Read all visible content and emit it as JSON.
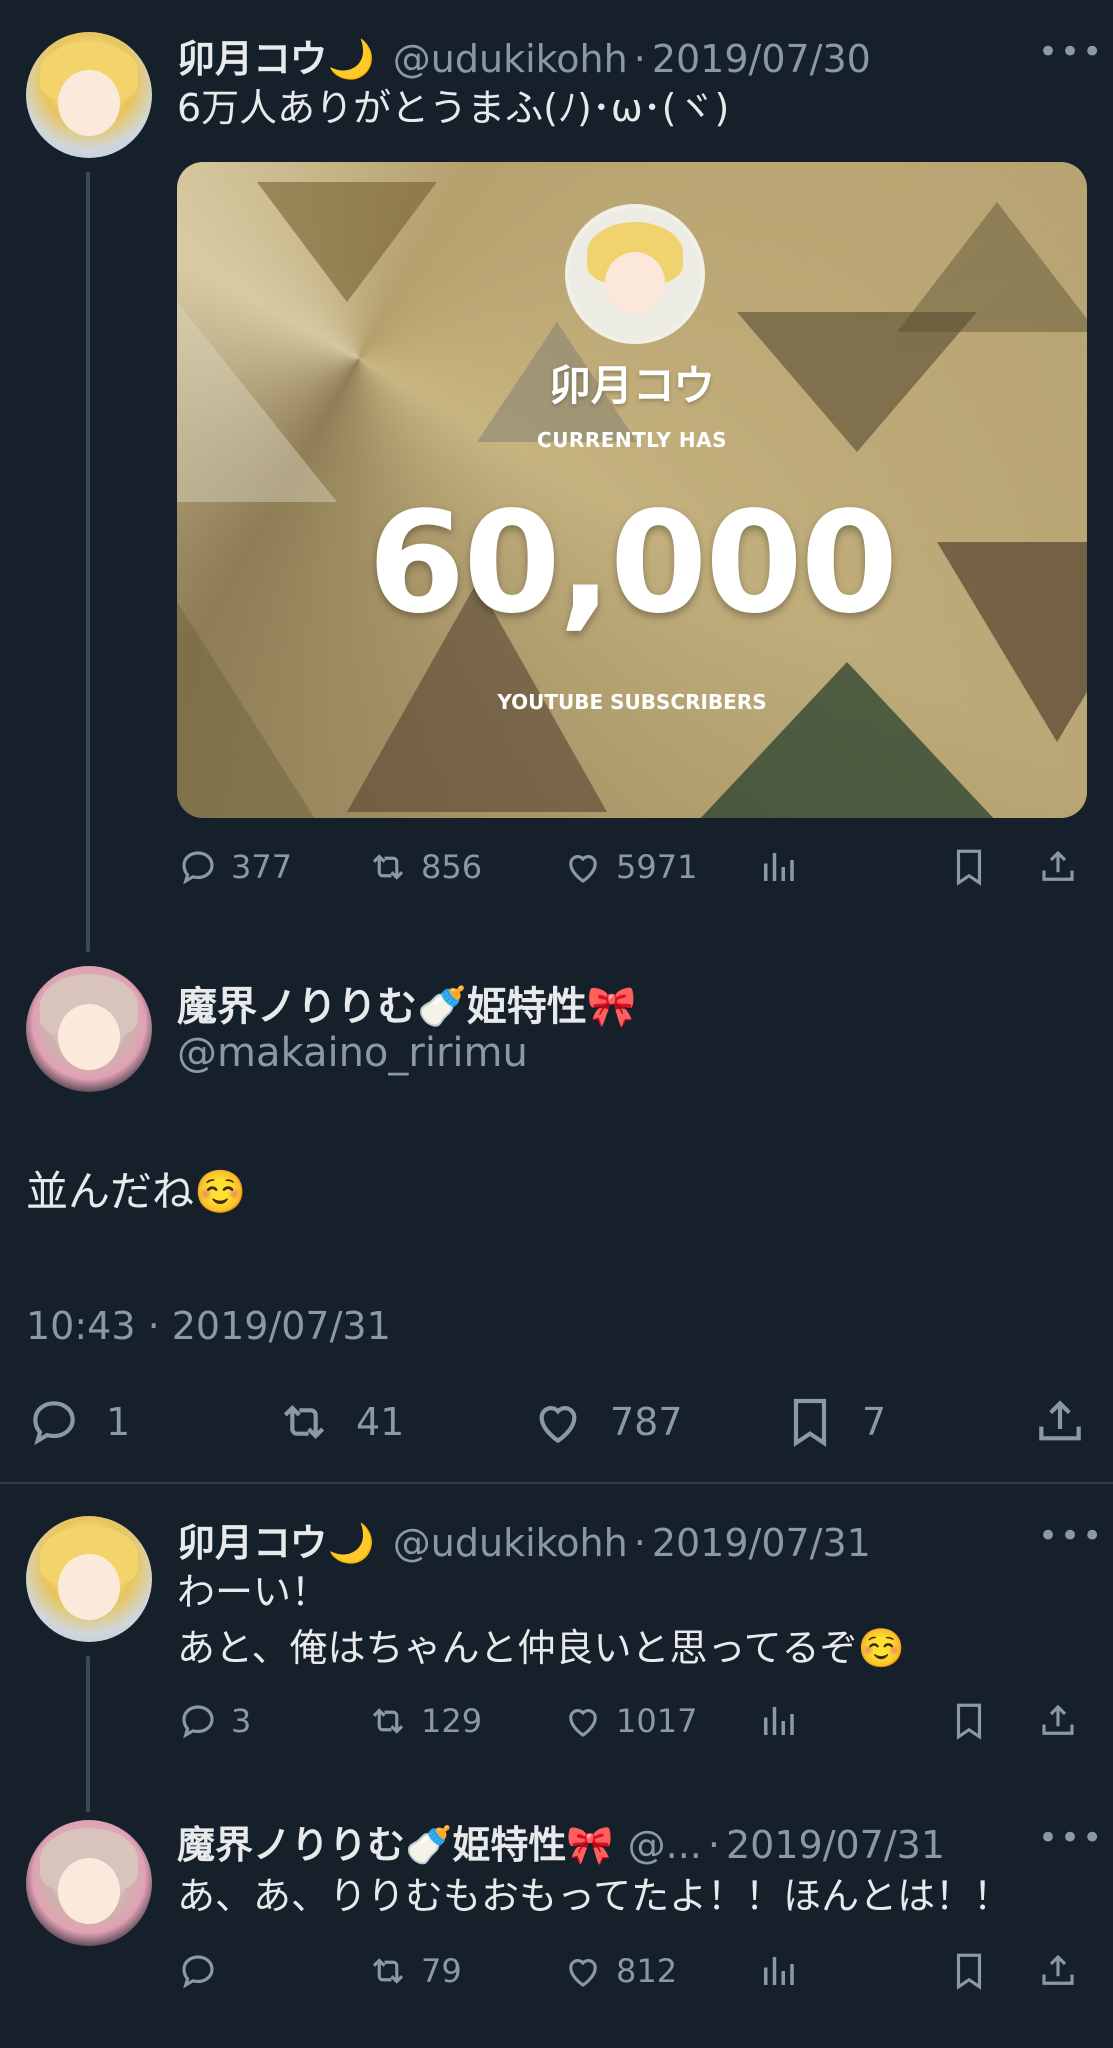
{
  "tweet1": {
    "name": "卯月コウ🌙",
    "handle": "@udukikohh",
    "sep": "·",
    "date": "2019/07/30",
    "more": "•••",
    "text": "6万人ありがとうまふ(ﾉ)･ω･(ヾ)",
    "card": {
      "name": "卯月コウ",
      "currently": "CURRENTLY HAS",
      "count": "60,000",
      "footer": "YOUTUBE SUBSCRIBERS"
    },
    "actions": {
      "replies": "377",
      "retweets": "856",
      "likes": "5971"
    }
  },
  "tweet2": {
    "name": "魔界ノりりむ🍼姫特性🎀",
    "handle": "@makaino_ririmu",
    "text": "並んだね☺️",
    "timestamp": "10:43 · 2019/07/31",
    "actions": {
      "replies": "1",
      "retweets": "41",
      "likes": "787",
      "bookmarks": "7"
    }
  },
  "tweet3": {
    "name": "卯月コウ🌙",
    "handle": "@udukikohh",
    "sep": "·",
    "date": "2019/07/31",
    "more": "•••",
    "line1": "わーい！",
    "line2": "あと、俺はちゃんと仲良いと思ってるぞ☺️",
    "actions": {
      "replies": "3",
      "retweets": "129",
      "likes": "1017"
    }
  },
  "tweet4": {
    "name": "魔界ノりりむ🍼姫特性🎀",
    "handle": "@...",
    "sep": "·",
    "date": "2019/07/31",
    "more": "•••",
    "text": "あ、あ、りりむもおもってたよ！！ほんとは！！",
    "actions": {
      "replies": "",
      "retweets": "79",
      "likes": "812"
    }
  },
  "icons": [
    "reply-icon",
    "retweet-icon",
    "like-icon",
    "views-icon",
    "bookmark-icon",
    "share-icon"
  ],
  "colors": {
    "background": "#15202b",
    "text": "#e7e9ea",
    "muted": "#8b98a5"
  }
}
